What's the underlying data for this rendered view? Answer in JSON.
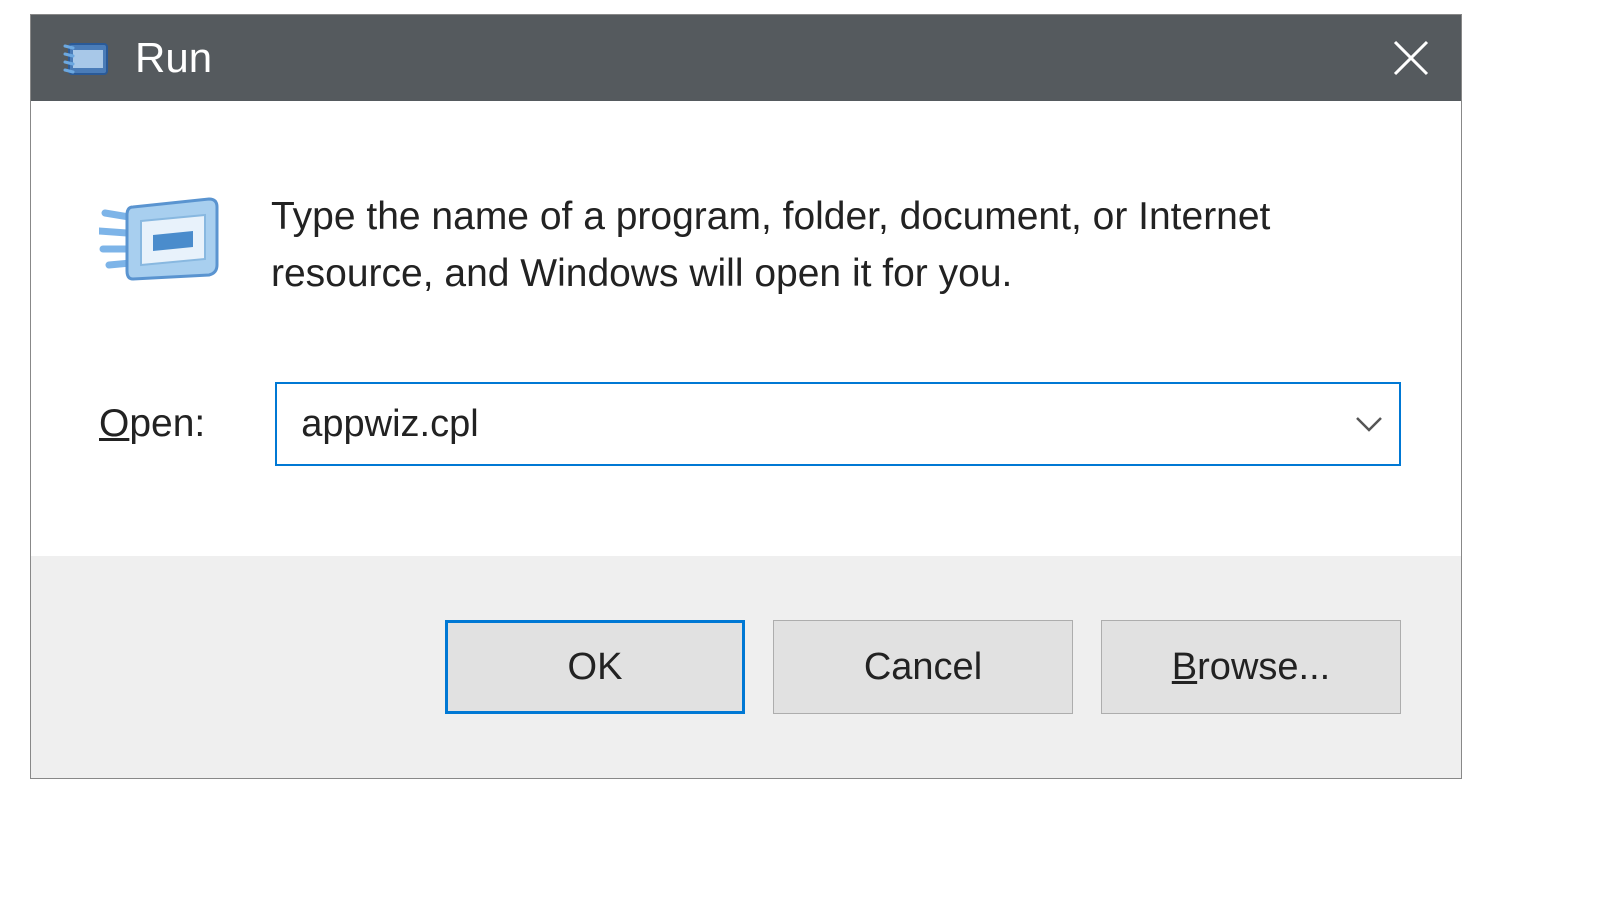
{
  "titlebar": {
    "title": "Run"
  },
  "instruction": "Type the name of a program, folder, document, or Internet resource, and Windows will open it for you.",
  "open": {
    "label_prefix": "O",
    "label_rest": "pen:",
    "value": "appwiz.cpl"
  },
  "buttons": {
    "ok": "OK",
    "cancel": "Cancel",
    "browse_prefix": "B",
    "browse_rest": "rowse..."
  }
}
